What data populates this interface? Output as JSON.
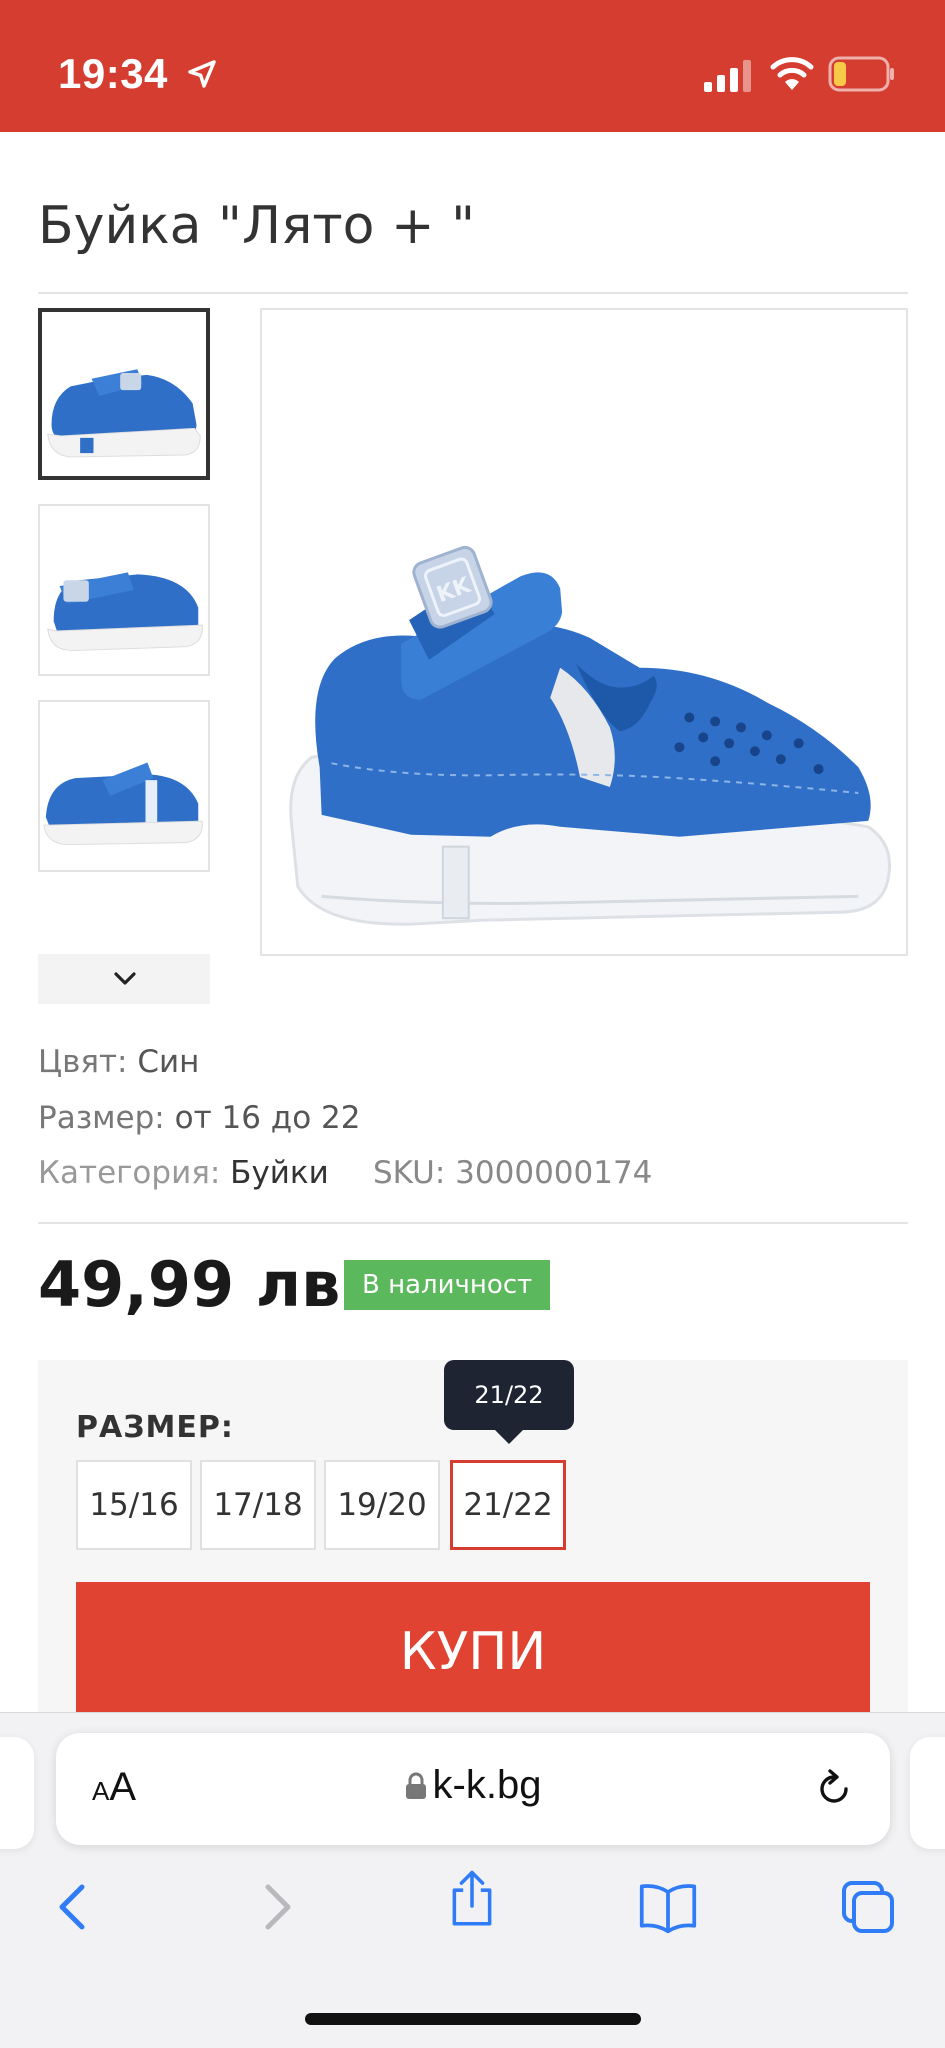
{
  "status_bar": {
    "time": "19:34"
  },
  "product": {
    "title": "Буйка \"Лято + \"",
    "color_label": "Цвят:",
    "color_value": "Син",
    "size_label": "Размер:",
    "size_value": "от 16 до 22",
    "category_label": "Категория:",
    "category_value": "Буйки",
    "sku_label": "SKU:",
    "sku_value": "3000000174",
    "price": "49,99 лв.",
    "stock": "В наличност"
  },
  "sizes": {
    "label": "РАЗМЕР:",
    "options": [
      "15/16",
      "17/18",
      "19/20",
      "21/22"
    ],
    "tooltip": "21/22"
  },
  "buy_button": "КУПИ",
  "browser": {
    "aa_small": "A",
    "aa_large": "A",
    "url": "k-k.bg"
  },
  "colors": {
    "brand_red": "#d43d2f",
    "buy_red": "#e04331",
    "stock_green": "#5cb85c",
    "ios_blue": "#2f7cf6",
    "shoe_blue": "#2f6fc7"
  },
  "icons": {
    "location": "location-arrow-icon",
    "signal": "cellular-signal-icon",
    "wifi": "wifi-icon",
    "battery": "battery-low-icon",
    "chevron": "chevron-down-icon",
    "lock": "lock-icon",
    "reload": "reload-icon",
    "back": "back-arrow-icon",
    "forward": "forward-arrow-icon",
    "share": "share-icon",
    "bookmarks": "bookmarks-icon",
    "tabs": "tabs-icon"
  }
}
